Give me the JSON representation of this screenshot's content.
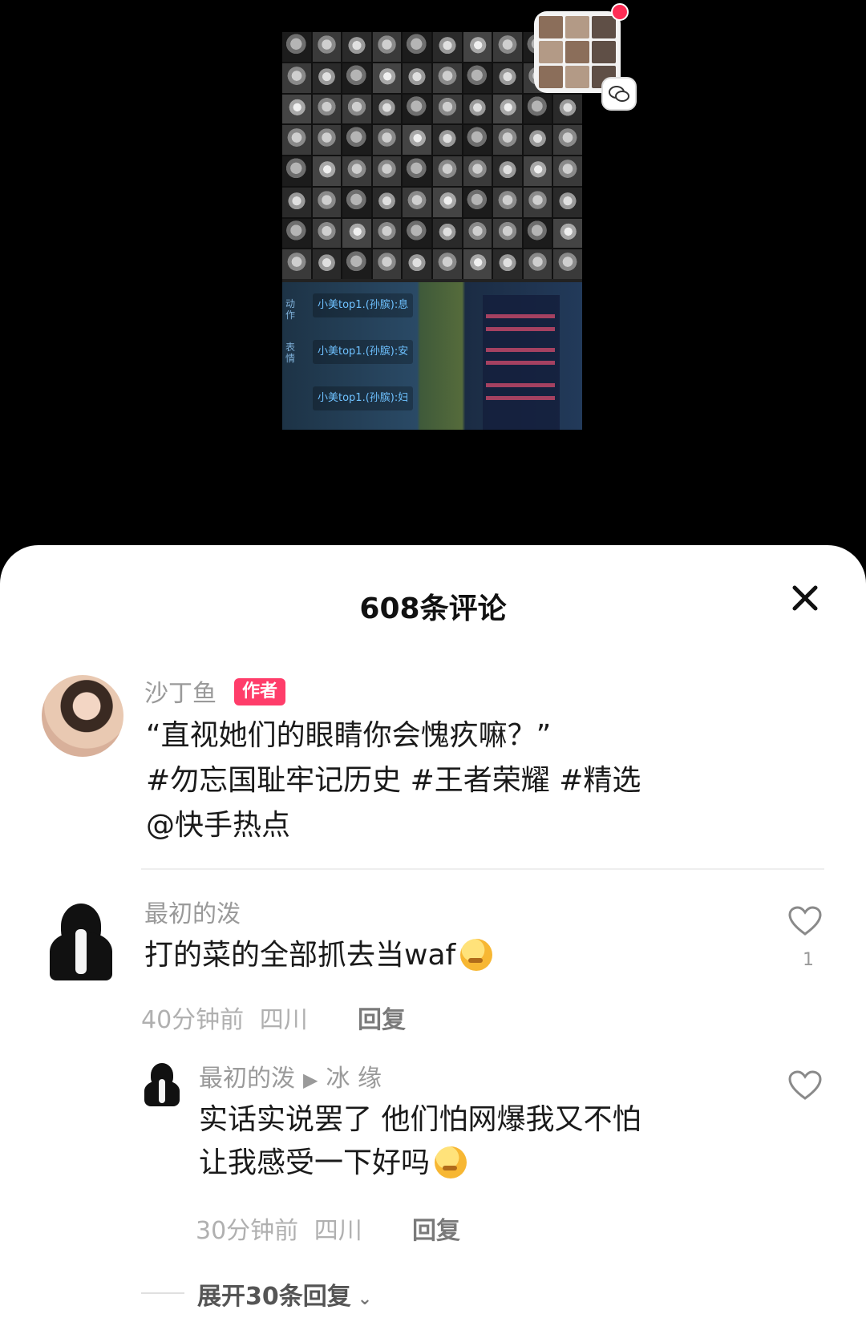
{
  "video": {
    "game_chat_lines": [
      "小美top1.(孙膑):息",
      "小美top1.(孙膑):安",
      "小美top1.(孙膑):妇"
    ],
    "game_side_labels": [
      "动作",
      "表情"
    ]
  },
  "sheet": {
    "title": "608条评论",
    "close_icon": "×"
  },
  "author": {
    "name": "沙丁鱼",
    "badge": "作者",
    "text_line1": "“直视她们的眼睛你会愧疚嘛？”",
    "text_line2": "#勿忘国耻牢记历史 #王者荣耀 #精选",
    "text_line3": "@快手热点"
  },
  "comments": [
    {
      "name": "最初的泼",
      "text": "打的菜的全部抓去当waf",
      "time": "40分钟前",
      "location": "四川",
      "reply_label": "回复",
      "likes": "1"
    },
    {
      "name": "最初的泼",
      "reply_to": "冰 缘",
      "text_line1": "实话实说罢了 他们怕网爆我又不怕",
      "text_line2": "让我感受一下好吗",
      "time": "30分钟前",
      "location": "四川",
      "reply_label": "回复"
    }
  ],
  "expand": {
    "label": "展开30条回复"
  },
  "colors": {
    "badge": "#ff3d6a",
    "notification": "#ff2d55"
  }
}
